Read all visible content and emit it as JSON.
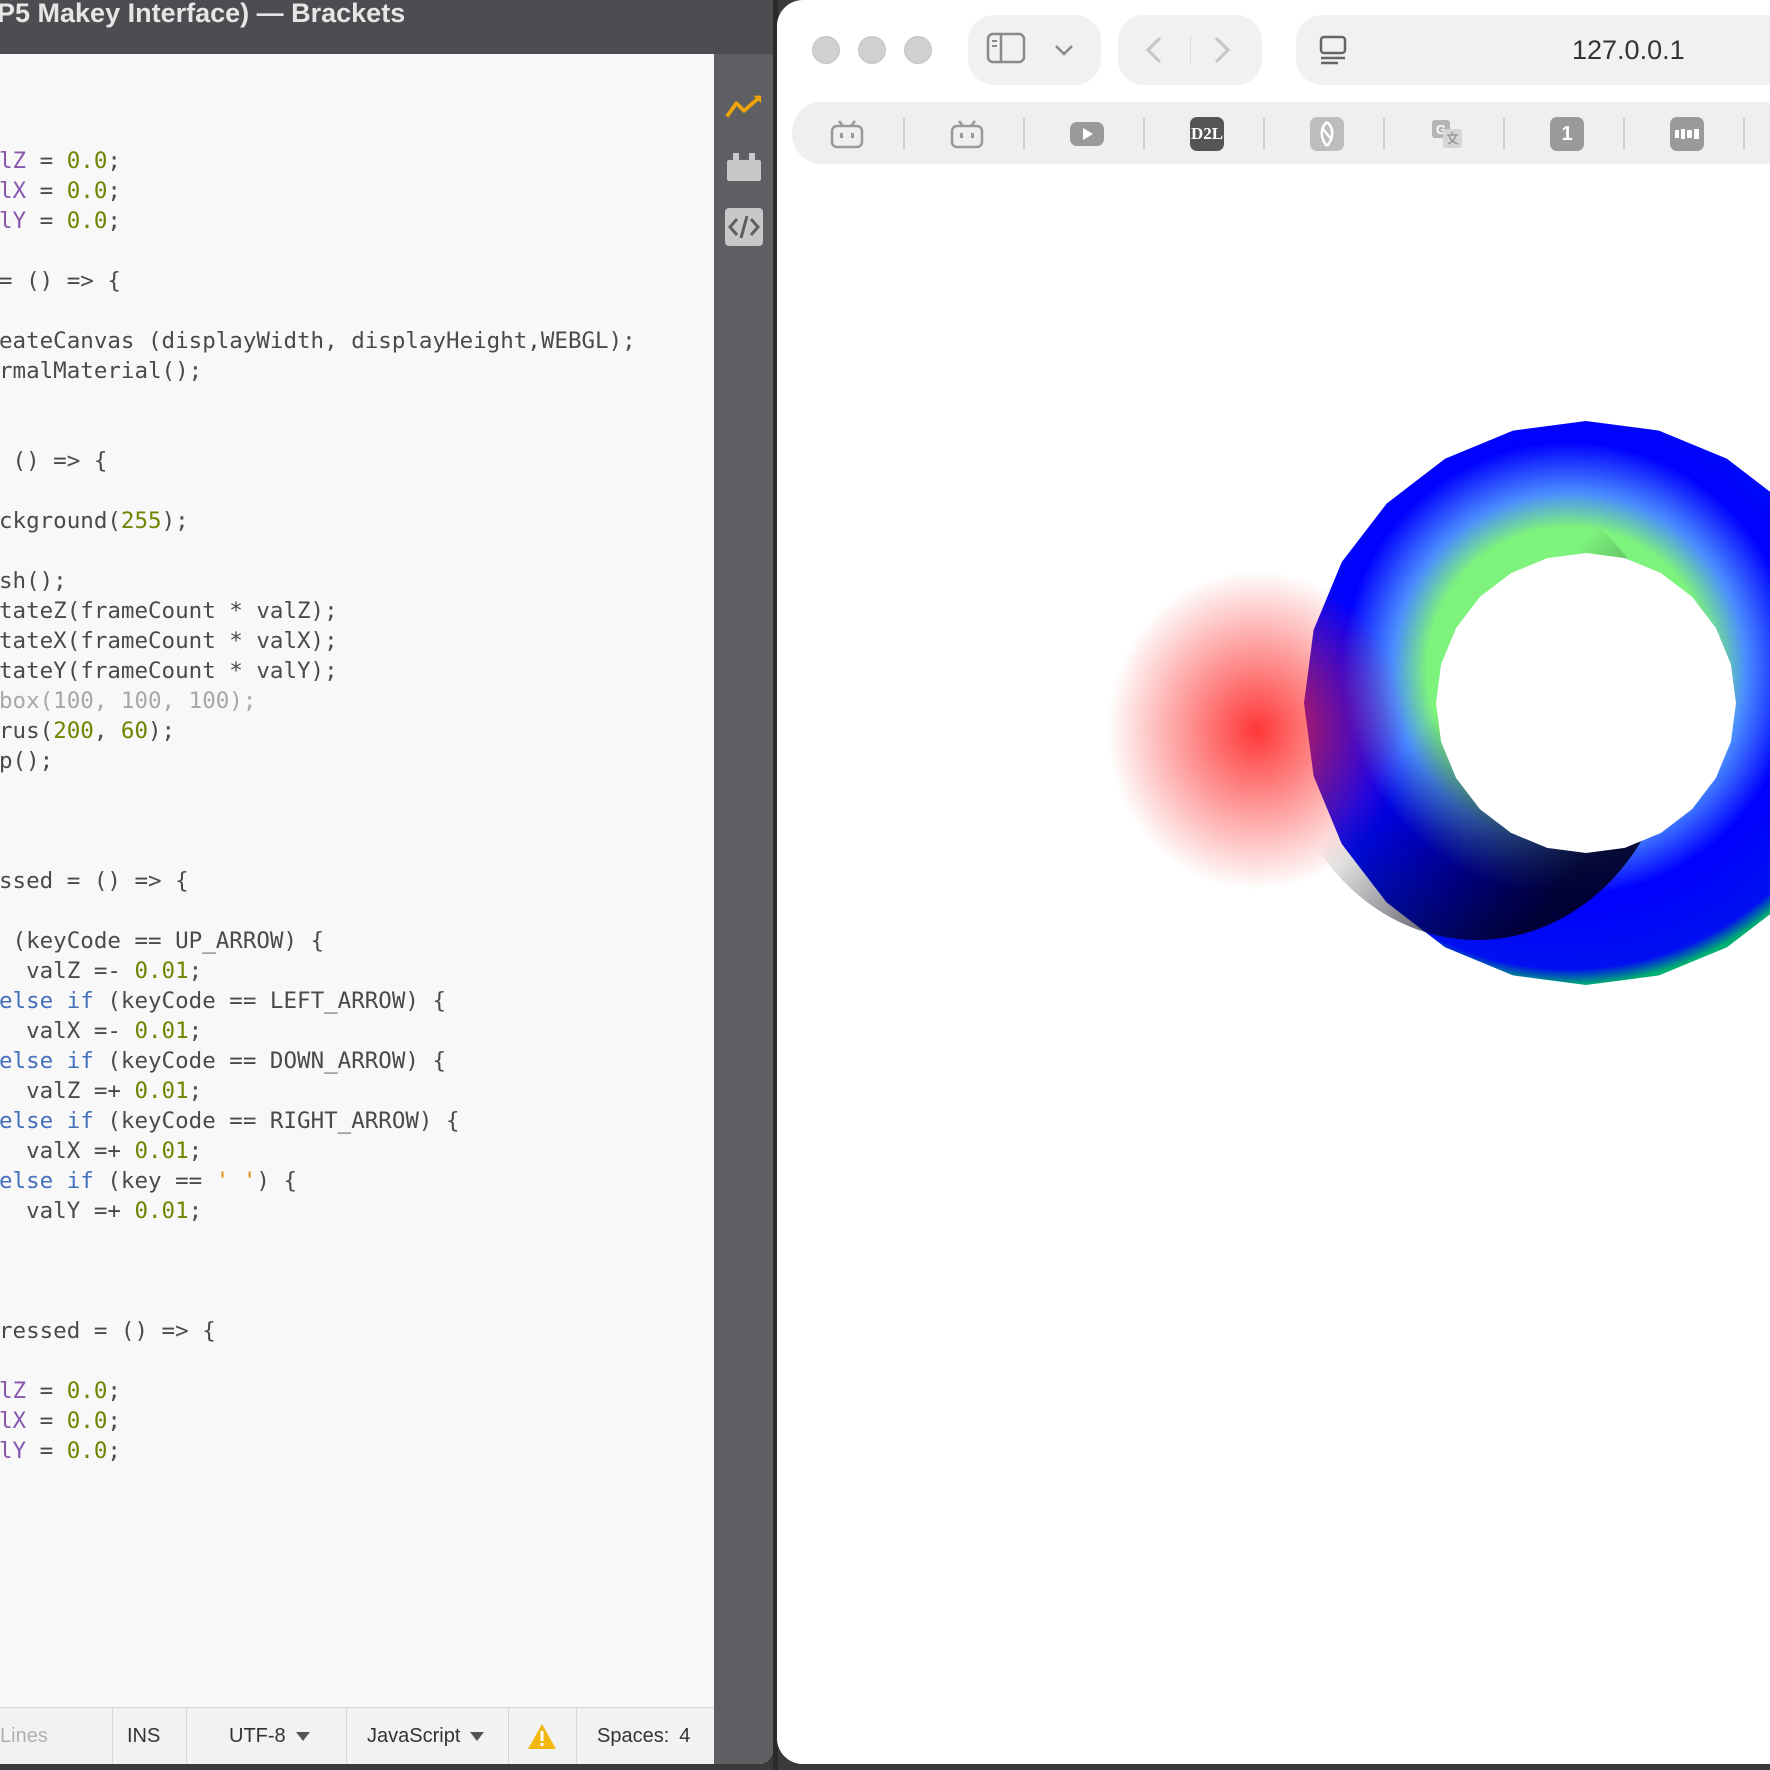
{
  "brackets": {
    "title": "P5 Makey Interface) — Brackets",
    "code_lines": [
      [],
      [
        {
          "t": "lZ",
          "c": "v"
        },
        {
          "t": " = "
        },
        {
          "t": "0.0",
          "c": "n"
        },
        {
          "t": ";"
        }
      ],
      [
        {
          "t": "lX",
          "c": "v"
        },
        {
          "t": " = "
        },
        {
          "t": "0.0",
          "c": "n"
        },
        {
          "t": ";"
        }
      ],
      [
        {
          "t": "lY",
          "c": "v"
        },
        {
          "t": " = "
        },
        {
          "t": "0.0",
          "c": "n"
        },
        {
          "t": ";"
        }
      ],
      [],
      [
        {
          "t": "= () => {"
        }
      ],
      [],
      [
        {
          "t": "eateCanvas (displayWidth, displayHeight,WEBGL);"
        }
      ],
      [
        {
          "t": "rmalMaterial();"
        }
      ],
      [],
      [],
      [
        {
          "t": " () => {"
        }
      ],
      [],
      [
        {
          "t": "ckground("
        },
        {
          "t": "255",
          "c": "n"
        },
        {
          "t": ");"
        }
      ],
      [],
      [
        {
          "t": "sh();"
        }
      ],
      [
        {
          "t": "tateZ(frameCount * valZ);"
        }
      ],
      [
        {
          "t": "tateX(frameCount * valX);"
        }
      ],
      [
        {
          "t": "tateY(frameCount * valY);"
        }
      ],
      [
        {
          "t": "box(100, 100, 100);",
          "c": "cm"
        }
      ],
      [
        {
          "t": "rus("
        },
        {
          "t": "200",
          "c": "n"
        },
        {
          "t": ", "
        },
        {
          "t": "60",
          "c": "n"
        },
        {
          "t": ");"
        }
      ],
      [
        {
          "t": "p();"
        }
      ],
      [],
      [],
      [],
      [
        {
          "t": "ssed = () => {"
        }
      ],
      [],
      [
        {
          "t": " (keyCode == UP_ARROW) {"
        }
      ],
      [
        {
          "t": "  valZ =- "
        },
        {
          "t": "0.01",
          "c": "n"
        },
        {
          "t": ";"
        }
      ],
      [
        {
          "t": "else if",
          "c": "k"
        },
        {
          "t": " (keyCode == LEFT_ARROW) {"
        }
      ],
      [
        {
          "t": "  valX =- "
        },
        {
          "t": "0.01",
          "c": "n"
        },
        {
          "t": ";"
        }
      ],
      [
        {
          "t": "else if",
          "c": "k"
        },
        {
          "t": " (keyCode == DOWN_ARROW) {"
        }
      ],
      [
        {
          "t": "  valZ =+ "
        },
        {
          "t": "0.01",
          "c": "n"
        },
        {
          "t": ";"
        }
      ],
      [
        {
          "t": "else if",
          "c": "k"
        },
        {
          "t": " (keyCode == RIGHT_ARROW) {"
        }
      ],
      [
        {
          "t": "  valX =+ "
        },
        {
          "t": "0.01",
          "c": "n"
        },
        {
          "t": ";"
        }
      ],
      [
        {
          "t": "else if",
          "c": "k"
        },
        {
          "t": " (key == "
        },
        {
          "t": "' '",
          "c": "s"
        },
        {
          "t": ") {"
        }
      ],
      [
        {
          "t": "  valY =+ "
        },
        {
          "t": "0.01",
          "c": "n"
        },
        {
          "t": ";"
        }
      ],
      [],
      [],
      [],
      [
        {
          "t": "ressed = () => {"
        }
      ],
      [],
      [
        {
          "t": "lZ",
          "c": "v"
        },
        {
          "t": " = "
        },
        {
          "t": "0.0",
          "c": "n"
        },
        {
          "t": ";"
        }
      ],
      [
        {
          "t": "lX",
          "c": "v"
        },
        {
          "t": " = "
        },
        {
          "t": "0.0",
          "c": "n"
        },
        {
          "t": ";"
        }
      ],
      [
        {
          "t": "lY",
          "c": "v"
        },
        {
          "t": " = "
        },
        {
          "t": "0.0",
          "c": "n"
        },
        {
          "t": ";"
        }
      ]
    ],
    "status": {
      "lines": "Lines",
      "mode": "INS",
      "encoding": "UTF-8",
      "language": "JavaScript",
      "spaces_label": "Spaces:",
      "spaces_value": "4"
    },
    "toolbar_icons": [
      "live-preview-icon",
      "extension-manager-icon",
      "code-inspector-icon"
    ],
    "colors": {
      "titlebar": "#4b4d50",
      "sidebar": "#5e5f62",
      "live_preview": "#f0a30a"
    }
  },
  "browser": {
    "url": "127.0.0.1",
    "favorites": [
      {
        "icon": "bilibili-icon",
        "label": ""
      },
      {
        "icon": "bilibili-icon",
        "label": ""
      },
      {
        "icon": "youtube-icon",
        "label": ""
      },
      {
        "icon": "d2l-icon",
        "label": "D2L"
      },
      {
        "icon": "brand-icon",
        "label": ""
      },
      {
        "icon": "translate-icon",
        "label": ""
      },
      {
        "icon": "number-one-icon",
        "label": "1"
      },
      {
        "icon": "app-icon",
        "label": ""
      }
    ],
    "torus_colors": {
      "outer": "#0000ff",
      "inner_top": "#6cf26c",
      "inner_left": "#ff2a2a",
      "shadow": "#000033"
    }
  }
}
